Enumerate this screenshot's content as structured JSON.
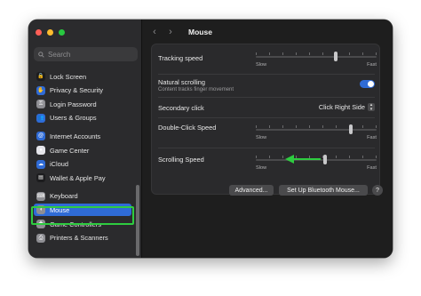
{
  "window": {
    "title": "Mouse",
    "back_icon": "chevron-left-icon",
    "forward_icon": "chevron-right-icon"
  },
  "sidebar": {
    "search_placeholder": "Search",
    "items": [
      {
        "label": "Lock Screen",
        "icon": "lock-icon",
        "color": "#1c1c1e",
        "glyph": "🔒",
        "selected": false
      },
      {
        "label": "Privacy & Security",
        "icon": "hand-icon",
        "color": "#2f6bd6",
        "glyph": "✋",
        "selected": false
      },
      {
        "label": "Login Password",
        "icon": "key-icon",
        "color": "#8e8e93",
        "glyph": "⚿",
        "selected": false
      },
      {
        "label": "Users & Groups",
        "icon": "users-icon",
        "color": "#2f6bd6",
        "glyph": "👥",
        "selected": false
      },
      {
        "label": "Internet Accounts",
        "icon": "at-icon",
        "color": "#2f6bd6",
        "glyph": "@",
        "selected": false
      },
      {
        "label": "Game Center",
        "icon": "game-center-icon",
        "color": "#e5e5ea",
        "glyph": "●",
        "selected": false
      },
      {
        "label": "iCloud",
        "icon": "icloud-icon",
        "color": "#2f6bd6",
        "glyph": "☁",
        "selected": false
      },
      {
        "label": "Wallet & Apple Pay",
        "icon": "wallet-icon",
        "color": "#1c1c1e",
        "glyph": "▤",
        "selected": false
      },
      {
        "label": "Keyboard",
        "icon": "keyboard-icon",
        "color": "#8e8e93",
        "glyph": "⌨",
        "selected": false
      },
      {
        "label": "Mouse",
        "icon": "mouse-icon",
        "color": "#8e8e93",
        "glyph": "◖",
        "selected": true
      },
      {
        "label": "Game Controllers",
        "icon": "gamepad-icon",
        "color": "#8e8e93",
        "glyph": "✚",
        "selected": false
      },
      {
        "label": "Printers & Scanners",
        "icon": "printer-icon",
        "color": "#8e8e93",
        "glyph": "⎙",
        "selected": false
      }
    ]
  },
  "settings": {
    "tracking_speed": {
      "label": "Tracking speed",
      "min_label": "Slow",
      "max_label": "Fast",
      "value": 0.66
    },
    "natural_scrolling": {
      "label": "Natural scrolling",
      "sublabel": "Content tracks finger movement",
      "on": true
    },
    "secondary_click": {
      "label": "Secondary click",
      "value": "Click Right Side"
    },
    "double_click_speed": {
      "label": "Double-Click Speed",
      "min_label": "Slow",
      "max_label": "Fast",
      "value": 0.79
    },
    "scrolling_speed": {
      "label": "Scrolling Speed",
      "min_label": "Slow",
      "max_label": "Fast",
      "value": 0.57
    }
  },
  "buttons": {
    "advanced": "Advanced...",
    "bluetooth": "Set Up Bluetooth Mouse...",
    "help": "?"
  },
  "colors": {
    "accent": "#2f6bd6",
    "highlight": "#2ecc40",
    "annotation_arrow": "#2ecc40"
  }
}
